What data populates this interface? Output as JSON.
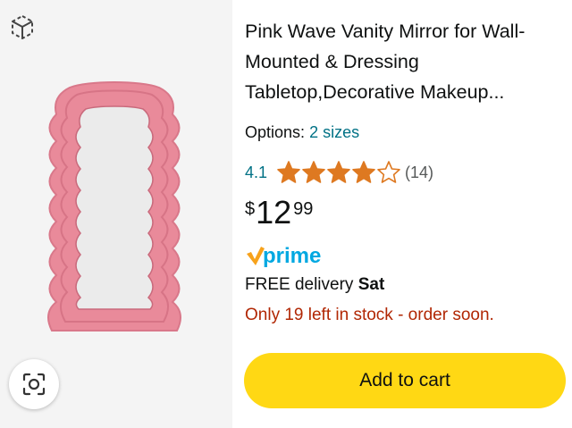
{
  "product": {
    "title": "Pink Wave Vanity Mirror for Wall-Mounted & Dressing Tabletop,Decorative Makeup...",
    "options_label": "Options:",
    "options_value": "2 sizes",
    "rating_value": "4.1",
    "rating_stars": 4.1,
    "rating_count": "(14)",
    "price_symbol": "$",
    "price_whole": "12",
    "price_fraction": "99",
    "prime_label": "prime",
    "delivery_prefix": "FREE delivery",
    "delivery_day": "Sat",
    "stock_notice": "Only 19 left in stock - order soon.",
    "add_to_cart_label": "Add to cart"
  },
  "icons": {
    "view_in_room": "ar-cube-icon",
    "visual_search": "camera-lens-icon",
    "star": "star-icon"
  },
  "colors": {
    "link": "#007185",
    "star": "#de7921",
    "stock": "#b12704",
    "button": "#ffd814",
    "mirror_frame": "#e98a9a",
    "prime": "#00a8e1"
  }
}
